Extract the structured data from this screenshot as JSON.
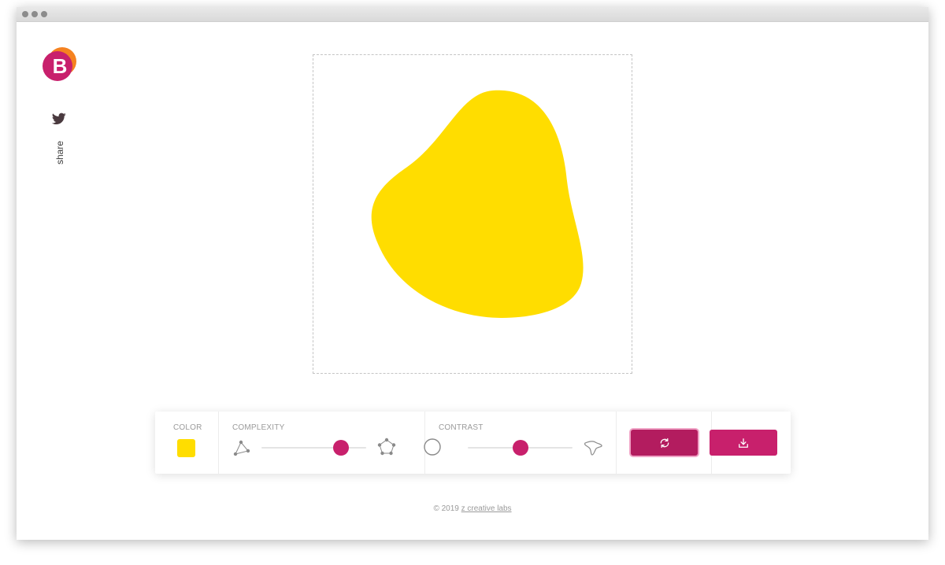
{
  "brand": {
    "logo_letter": "B"
  },
  "sidebar": {
    "share_label": "share"
  },
  "controls": {
    "color_label": "COLOR",
    "complexity_label": "COMPLEXITY",
    "contrast_label": "CONTRAST",
    "complexity_value": 0.76,
    "contrast_value": 0.5
  },
  "footer": {
    "copyright": "© 2019",
    "link_text": "z creative labs"
  },
  "colors": {
    "blob": "#FFDD00",
    "accent": "#C8206C",
    "accent_dark": "#B31C5F",
    "logo_orange": "#F58220",
    "logo_magenta": "#C8206C"
  },
  "icons": {
    "twitter": "twitter-icon",
    "low_complexity": "triangle-nodes-icon",
    "high_complexity": "pentagon-nodes-icon",
    "low_contrast": "circle-icon",
    "high_contrast": "star-blob-icon",
    "regenerate": "refresh-icon",
    "download": "download-icon"
  }
}
